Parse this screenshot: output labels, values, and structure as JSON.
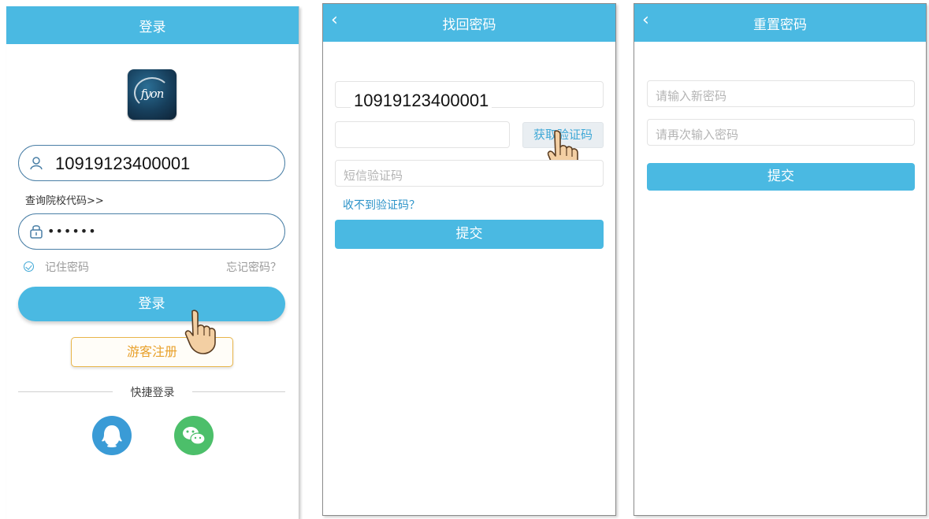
{
  "colors": {
    "accent": "#4ab9e2",
    "guest": "#e8a02a",
    "link": "#2c93c8",
    "qq": "#3a9bd6",
    "wechat": "#4cbf6a"
  },
  "login": {
    "title": "登录",
    "logo_text": "fyon",
    "account_value": "10919123400001",
    "school_code_link": "查询院校代码>>",
    "password_mask": "••••••",
    "remember_label": "记住密码",
    "forgot_label": "忘记密码？",
    "login_button": "登录",
    "guest_button": "游客注册",
    "quick_login_label": "快捷登录",
    "social_icons": [
      "qq-icon",
      "wechat-icon"
    ]
  },
  "find_password": {
    "back_icon": "chevron-left-icon",
    "back_glyph": "‹",
    "title": "找回密码",
    "phone_value": "10919123400001",
    "get_code_button": "获取验证码",
    "sms_placeholder": "短信验证码",
    "no_code_link": "收不到验证码？",
    "submit_button": "提交"
  },
  "reset_password": {
    "back_icon": "chevron-left-icon",
    "back_glyph": "‹",
    "title": "重置密码",
    "new_password_placeholder": "请输入新密码",
    "confirm_password_placeholder": "请再次输入密码",
    "submit_button": "提交"
  }
}
